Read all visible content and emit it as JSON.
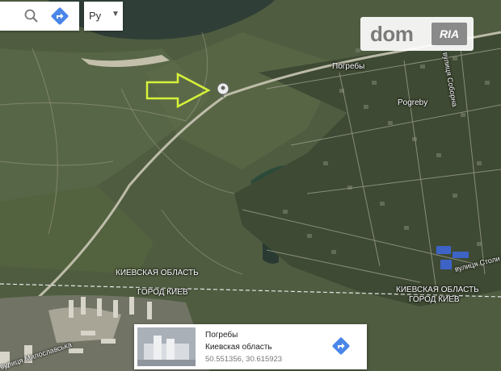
{
  "map": {
    "labels": {
      "pogreby_ru": "Погребы",
      "pogreby_en": "Pogreby",
      "street_sobornaya": "вулиця Соборна",
      "street_stolychna": "вулиця Столи",
      "street_miloslavska": "вулиця Милославська",
      "border_left_1": "КИЕВСКАЯ ОБЛАСТЬ",
      "border_left_2": "ГОРОД КИЕВ",
      "border_right_1": "КИЕВСКАЯ ОБЛАСТЬ",
      "border_right_2": "ГОРОД КИЕВ"
    }
  },
  "toolbar": {
    "search_icon": "search-icon",
    "directions_icon": "directions-icon",
    "language_value": "Ру"
  },
  "logo": {
    "name": "dom",
    "badge": "RIA"
  },
  "place_card": {
    "title": "Погребы",
    "region": "Киевская область",
    "coordinates": "50.551356, 30.615923"
  },
  "colors": {
    "arrow": "#d7f23a",
    "directions_blue": "#4a86e8"
  }
}
